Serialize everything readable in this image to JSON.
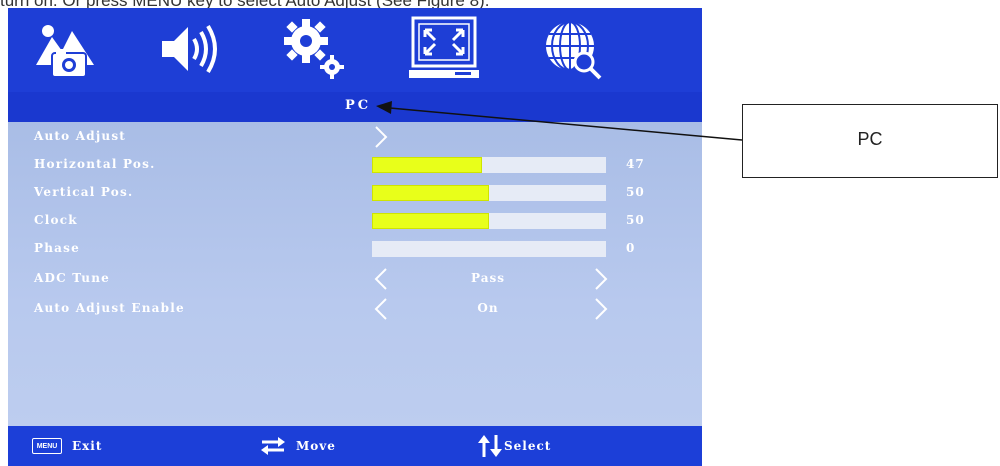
{
  "caption": {
    "text": "turn on. Or press MENU key to select Auto Adjust (See Figure 8)."
  },
  "osd": {
    "icons": [
      {
        "name": "picture-icon"
      },
      {
        "name": "sound-icon"
      },
      {
        "name": "settings-icon"
      },
      {
        "name": "pc-screen-icon",
        "selected": true
      },
      {
        "name": "globe-language-icon"
      }
    ],
    "title": "PC",
    "rows": [
      {
        "label": "Auto Adjust",
        "type": "action"
      },
      {
        "label": "Horizontal Pos.",
        "type": "slider",
        "value": "47",
        "fill": 0.47
      },
      {
        "label": "Vertical Pos.",
        "type": "slider",
        "value": "50",
        "fill": 0.5
      },
      {
        "label": "Clock",
        "type": "slider",
        "value": "50",
        "fill": 0.5
      },
      {
        "label": "Phase",
        "type": "slider",
        "value": "0",
        "fill": 0.0
      },
      {
        "label": "ADC Tune",
        "type": "option",
        "value": "Pass"
      },
      {
        "label": "Auto Adjust Enable",
        "type": "option",
        "value": "On"
      }
    ],
    "footer": {
      "menu_badge": "MENU",
      "exit": "Exit",
      "move": "Move",
      "select": "Select"
    },
    "colors": {
      "bar_fill": "#e8ff1a",
      "background": "#1c3fd8",
      "panel": "#b3c6ec"
    }
  },
  "callout": {
    "text": "PC"
  }
}
